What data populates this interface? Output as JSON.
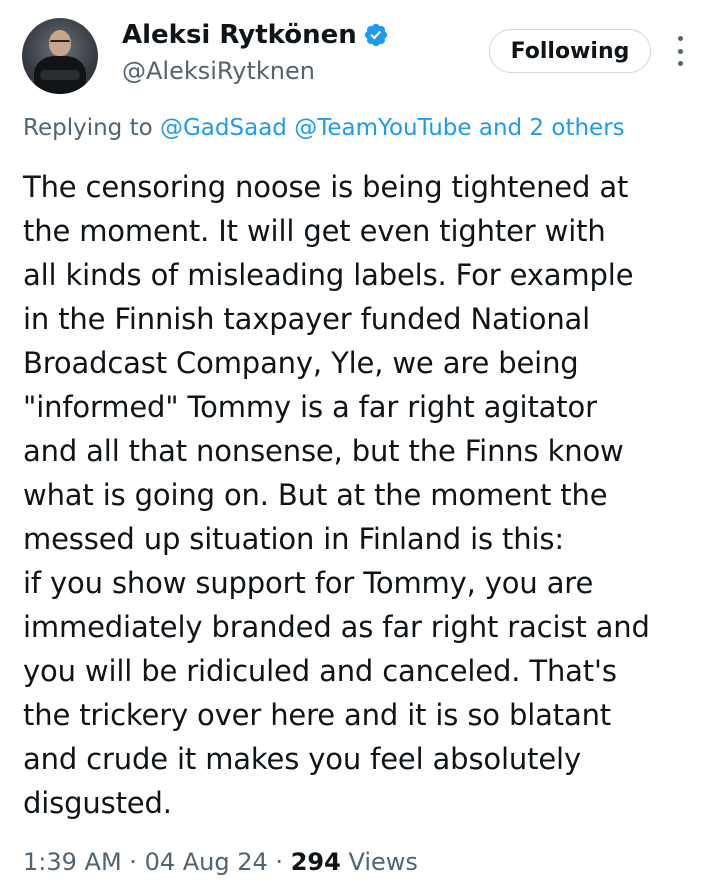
{
  "author": {
    "display_name": "Aleksi Rytkönen",
    "handle": "@AleksiRytknen",
    "verified": true,
    "verified_icon": "verified-badge-icon",
    "verified_color": "#1d9bf0"
  },
  "follow_button": {
    "label": "Following"
  },
  "more_menu": {
    "icon": "more-vertical-icon"
  },
  "reply_context": {
    "prefix": "Replying to",
    "mention_1": "@GadSaad",
    "mention_2": "@TeamYouTube",
    "others": "and 2 others"
  },
  "tweet": {
    "text": "The censoring noose is being tightened at\nthe moment. It will get even tighter with\nall kinds of misleading labels. For example\nin the Finnish taxpayer funded National\nBroadcast Company, Yle, we are being\n\"informed\" Tommy is a far right agitator\nand all that nonsense, but the Finns know\nwhat is going on. But at the moment the\nmessed up situation in Finland is this:\nif you show support for Tommy, you are\nimmediately branded as far right racist and\nyou will be ridiculed and canceled. That's\nthe trickery over here and it is so blatant\nand crude it makes you feel absolutely\ndisgusted."
  },
  "meta": {
    "time": "1:39 AM",
    "separator": "·",
    "date": "04 Aug 24",
    "views_count": "294",
    "views_label": "Views"
  },
  "colors": {
    "link": "#1d9bf0",
    "secondary_text": "#536471",
    "primary_text": "#0f1419",
    "button_border": "#cfd9de"
  }
}
